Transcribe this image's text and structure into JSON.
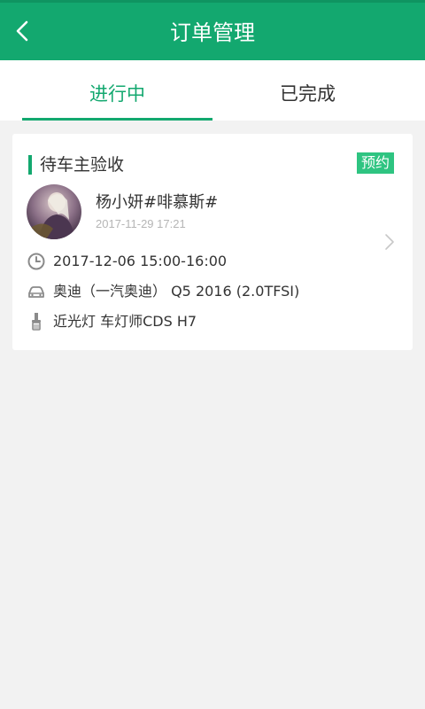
{
  "header": {
    "title": "订单管理"
  },
  "tabs": [
    {
      "label": "进行中"
    },
    {
      "label": "已完成"
    }
  ],
  "order": {
    "status": "待车主验收",
    "badge": "预约",
    "customer": "杨小妍#啡慕斯#",
    "created_at": "2017-11-29 17:21",
    "appointment": "2017-12-06 15:00-16:00",
    "car": "奥迪（一汽奥迪） Q5 2016 (2.0TFSI)",
    "product": "近光灯 车灯师CDS H7"
  },
  "colors": {
    "primary": "#13a86f",
    "badge": "#2ec481",
    "background": "#f2f2f2"
  },
  "icons": [
    "back-arrow-icon",
    "clock-icon",
    "car-icon",
    "bulb-icon",
    "chevron-right-icon"
  ]
}
